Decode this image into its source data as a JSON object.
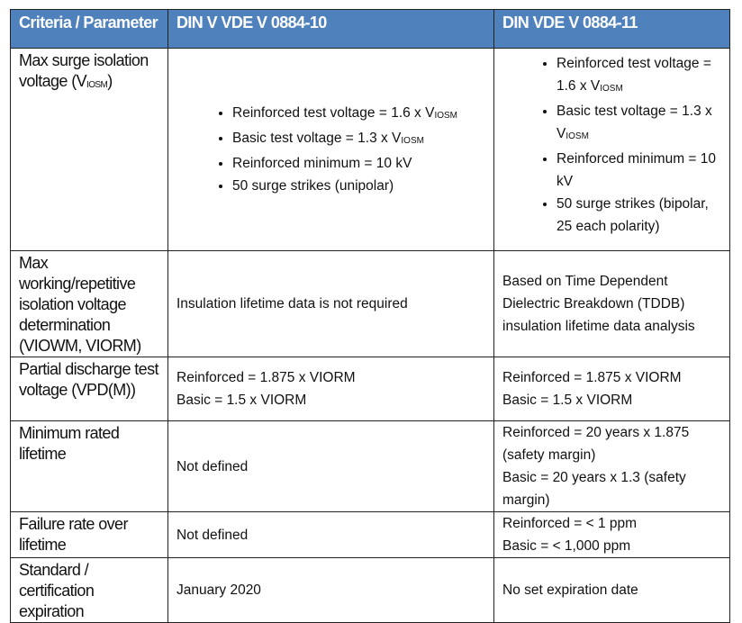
{
  "header": [
    "Criteria / Parameter",
    "DIN V VDE V 0884-10",
    "DIN VDE V 0884-11"
  ],
  "header_color": "#4f81bd",
  "rows": [
    {
      "criteria": {
        "text": "Max surge isolation voltage (V",
        "sub": "IOSM",
        "after": ")"
      },
      "col1_bullets": [
        {
          "text": "Reinforced test voltage = 1.6 x V",
          "sub": "IOSM"
        },
        {
          "text": "Basic test voltage = 1.3 x V",
          "sub": "IOSM"
        },
        {
          "text": "Reinforced minimum = 10 kV",
          "sub": ""
        },
        {
          "text": "50 surge strikes (unipolar)",
          "sub": ""
        }
      ],
      "col2_bullets": [
        {
          "text": "Reinforced test voltage = 1.6 x V",
          "sub": "IOSM"
        },
        {
          "text": "Basic test voltage = 1.3 x V",
          "sub": "IOSM"
        },
        {
          "text": "Reinforced minimum = 10 kV",
          "sub": ""
        },
        {
          "text": "50 surge strikes (bipolar, 25 each polarity)",
          "sub": ""
        }
      ]
    },
    {
      "criteria": "Max working/repetitive isolation voltage determination (VIOWM, VIORM)",
      "col1": [
        "Insulation lifetime data is not required"
      ],
      "col2": [
        "Based on Time Dependent Dielectric Breakdown (TDDB) insulation lifetime data analysis"
      ]
    },
    {
      "criteria": "Partial discharge test voltage (VPD(M))",
      "col1": [
        "Reinforced = 1.875 x VIORM",
        "Basic = 1.5 x VIORM"
      ],
      "col2": [
        "Reinforced = 1.875 x VIORM",
        "Basic = 1.5 x VIORM"
      ]
    },
    {
      "criteria": "Minimum rated lifetime",
      "col1": [
        "Not defined"
      ],
      "col2": [
        "Reinforced = 20 years x 1.875 (safety margin)",
        "Basic = 20 years x 1.3 (safety margin)"
      ]
    },
    {
      "criteria": "Failure rate over lifetime",
      "col1": [
        "Not defined"
      ],
      "col2": [
        "Reinforced = < 1 ppm",
        "Basic = < 1,000 ppm"
      ]
    },
    {
      "criteria": "Standard / certification expiration",
      "col1": [
        "January 2020"
      ],
      "col2": [
        "No set expiration date"
      ]
    }
  ]
}
